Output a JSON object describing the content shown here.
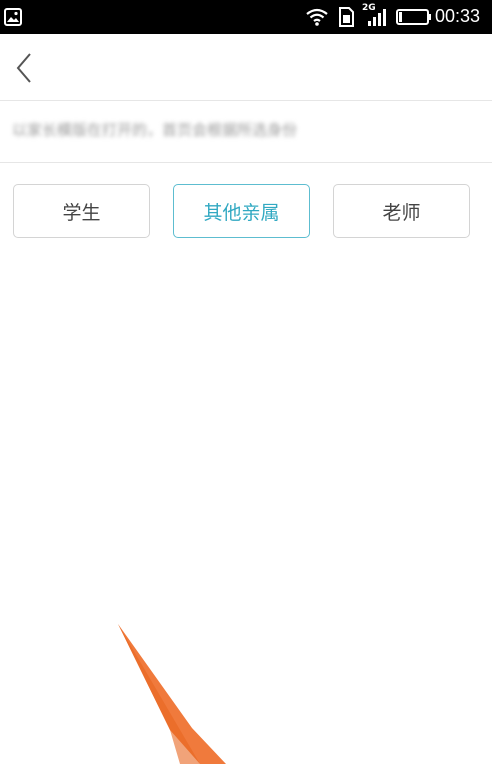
{
  "status_bar": {
    "network_type": "2G",
    "time": "00:33"
  },
  "hint_text": "以家长模版在打开的，首页会根据所选身份",
  "roles": [
    {
      "label": "学生",
      "selected": false
    },
    {
      "label": "其他亲属",
      "selected": true
    },
    {
      "label": "老师",
      "selected": false
    }
  ],
  "colors": {
    "accent": "#32a9c2",
    "arrow": "#f07a3c",
    "status_bar_bg": "#000000"
  }
}
